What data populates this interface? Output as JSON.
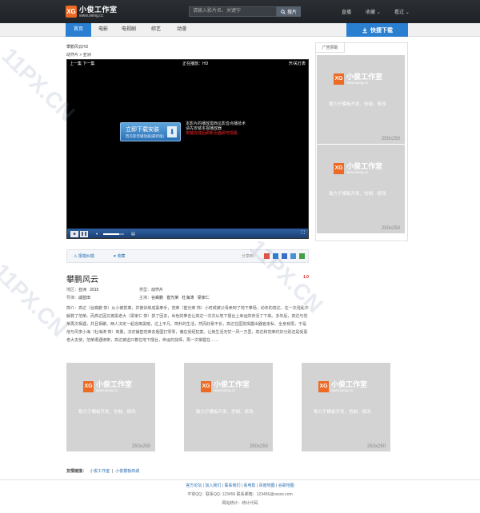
{
  "brand": {
    "mark": "XG",
    "name": "小俊工作室",
    "domain": "www.xieng.cc",
    "slogan": "致力于模板开发、仿制、修改",
    "accent": "#2a7fd1",
    "logo_color": "#ec6a23"
  },
  "header": {
    "search_placeholder": "请输入影片名、关键字",
    "search_button": "搜片",
    "links": [
      "直播",
      "收藏",
      "看过"
    ]
  },
  "nav": {
    "items": [
      "首页",
      "电影",
      "电视剧",
      "综艺",
      "动漫"
    ],
    "active": 0,
    "download_button": "快捷下载"
  },
  "breadcrumb": {
    "line1": "攀鹏风云HD",
    "line2": "动作片 > 亚洲"
  },
  "player": {
    "prev_next": "上一集 下一集",
    "now_playing": "正在播放：HD",
    "toggle_lights": "开/关灯表",
    "install_button": "立即下载安装",
    "install_sub": "西瓜影音播放器(最新版)",
    "info_lines": [
      "本影片的播放需西瓜影音点播技术",
      "请先安装本视播放器"
    ],
    "warning": "安装完成后刷新页面即可观看"
  },
  "share": {
    "report": "报错纠错",
    "favorite": "收藏",
    "share_label": "分享到："
  },
  "movie": {
    "title": "攀鹏风云",
    "score": "1.0",
    "region_label": "地区：",
    "region": "亚洲",
    "year": "2015",
    "type_label": "类型：",
    "type": "动作片",
    "director_label": "导演：",
    "director": "戚蓝田",
    "actor_label": "主演：",
    "actors": [
      "谷裔鹏",
      "崔光荣",
      "杜海涛",
      "梁家仁"
    ],
    "desc_label": "简介：",
    "description": "高达（谷裔鹏 饰）从小被抓离，并被训练成黑拳手，范荣（崔光荣 饰）小时候被父母卖到了地下拳场，幼年的高达、在一次混乱中解救了范荣。而高达因又被黑老大（梁家仁 饰）抓了回去，出色的拳击让高达一次次从地下擂台上幸运的存活了下来。多年后，高达与范荣再次相遇，并且相聚。两人决定一起逃离黑暗，过上平凡、简朴的生活，然而好景不长，高达在医院揭露出器官走私、全身有限，于是他与风李小海（杜海涛 饰）商量，决定铺垫范荣去悉国打零零，偏在受经犯案。让她生活无忧一风一万里，高达和范荣约好分别还是受黑老大支使，范荣遭遇绑架，高达被迫只着在地下擂台，命运的抉择，再一次掌握在……"
  },
  "ads": {
    "sidebar_tab": "广告赞助",
    "size_label": "250x250"
  },
  "friends": {
    "label": "友情链接：",
    "links": [
      "小俊工作室",
      "小俊模板商城"
    ]
  },
  "footer": {
    "links": [
      "官方论坛",
      "加入我们",
      "联系我们",
      "看电影",
      "百度地图",
      "谷歌地图"
    ],
    "contact": "平常QQ：联系QQ: 123456 联系邮箱：123456@xxxxx.com",
    "stats": "网站统计：统计代码"
  },
  "watermark": "11PX.CN"
}
